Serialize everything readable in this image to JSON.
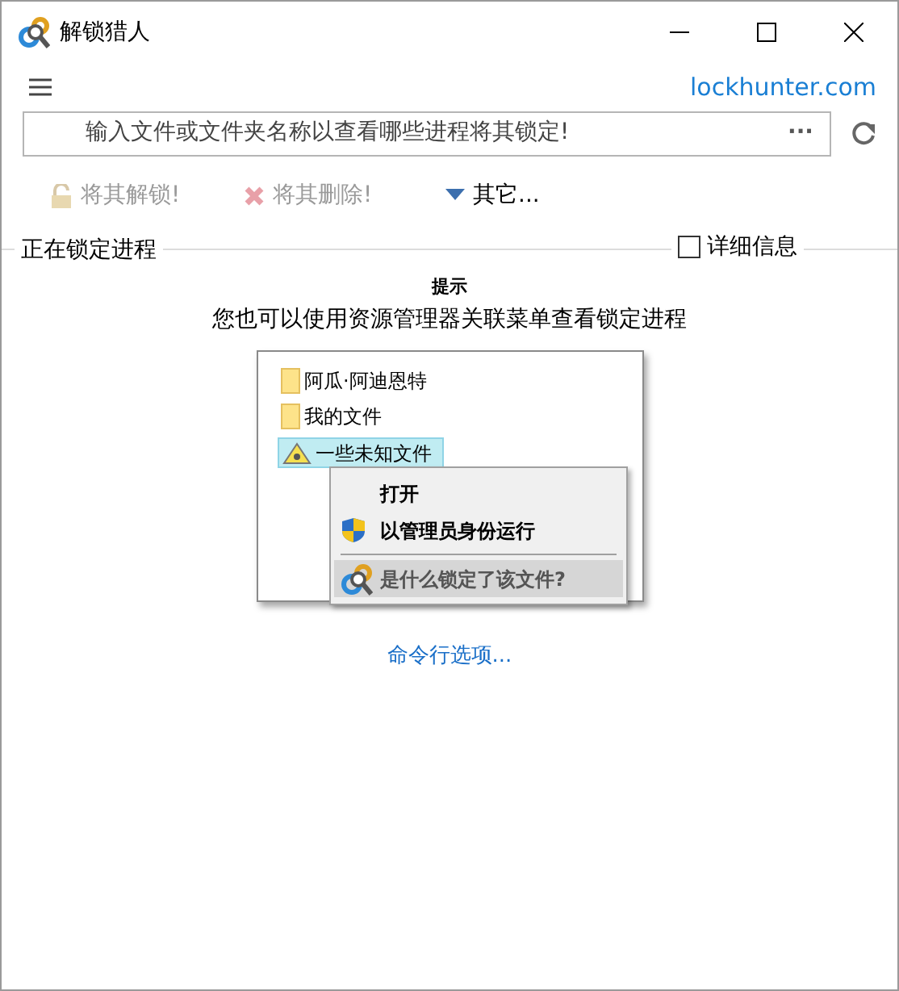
{
  "window": {
    "title": "解锁猎人"
  },
  "website_link": "lockhunter.com",
  "path_field": {
    "placeholder": "输入文件或文件夹名称以查看哪些进程将其锁定!",
    "browse": "···"
  },
  "toolbar": [
    {
      "kind": "unlock",
      "label": "将其解锁!",
      "disabled": true
    },
    {
      "kind": "delete",
      "label": "将其删除!",
      "disabled": true
    },
    {
      "kind": "other",
      "label": "其它...",
      "disabled": false
    }
  ],
  "process_group": {
    "title": "正在锁定进程",
    "details": {
      "label": "详细信息",
      "checked": false
    }
  },
  "tip": {
    "title": "提示",
    "text": "您也可以使用资源管理器关联菜单查看锁定进程"
  },
  "example": {
    "files": [
      {
        "kind": "folder",
        "name": "阿瓜·阿迪恩特",
        "selected": false
      },
      {
        "kind": "folder",
        "name": "我的文件",
        "selected": false
      },
      {
        "kind": "hazard",
        "name": "一些未知文件",
        "selected": true
      }
    ],
    "context_menu": [
      {
        "kind": "plain",
        "label": "打开",
        "highlighted": false
      },
      {
        "kind": "shield",
        "label": "以管理员身份运行",
        "highlighted": false
      },
      {
        "kind": "lockhunter",
        "label": "是什么锁定了该文件?",
        "highlighted": true
      }
    ]
  },
  "command_line_link": "命令行选项..."
}
